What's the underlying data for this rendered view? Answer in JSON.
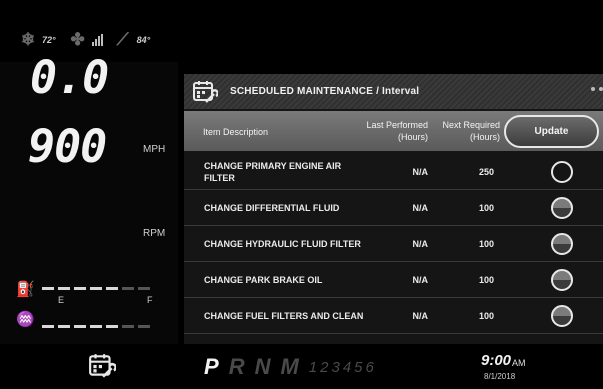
{
  "status": {
    "ambient_temp": "72°",
    "fan_signal_label": "",
    "fluid_temp": "84°"
  },
  "gauges": {
    "speed_value": "0.0",
    "speed_unit": "MPH",
    "rpm_value": "900",
    "rpm_unit": "RPM",
    "fuel_empty_label": "E",
    "fuel_full_label": "F"
  },
  "panel": {
    "title": "SCHEDULED MAINTENANCE / Interval",
    "columns": {
      "description": "Item Description",
      "last_performed": "Last Performed\n(Hours)",
      "next_required": "Next Required\n(Hours)"
    },
    "update_label": "Update",
    "rows": [
      {
        "description": "CHANGE PRIMARY ENGINE AIR FILTER",
        "last": "N/A",
        "next": "250",
        "status": "empty"
      },
      {
        "description": "CHANGE DIFFERENTIAL FLUID",
        "last": "N/A",
        "next": "100",
        "status": "half"
      },
      {
        "description": "CHANGE HYDRAULIC FLUID FILTER",
        "last": "N/A",
        "next": "100",
        "status": "half"
      },
      {
        "description": "CHANGE PARK BRAKE OIL",
        "last": "N/A",
        "next": "100",
        "status": "half"
      },
      {
        "description": "CHANGE FUEL FILTERS AND CLEAN",
        "last": "N/A",
        "next": "100",
        "status": "half"
      }
    ]
  },
  "bottom": {
    "gear_selected": "P",
    "gears_letters": [
      "R",
      "N",
      "M"
    ],
    "gears_numbers": "123456",
    "time": "9:00",
    "ampm": "AM",
    "date": "8/1/2018"
  },
  "colors": {
    "background": "#000000",
    "panel": "#151515",
    "accent": "#e8e8e8"
  }
}
